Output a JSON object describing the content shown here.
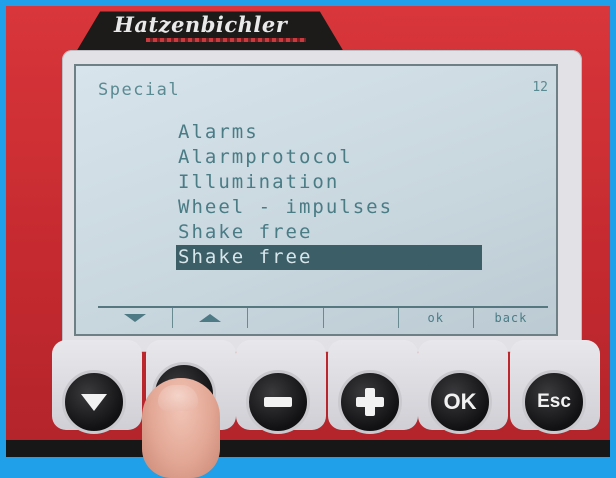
{
  "device": {
    "brand": "Hatzenbichler",
    "accent_color": "#c52a30"
  },
  "screen": {
    "title": "Special",
    "page_number": "12",
    "menu_items": [
      {
        "label": "Alarms",
        "selected": false
      },
      {
        "label": "Alarmprotocol",
        "selected": false
      },
      {
        "label": "Illumination",
        "selected": false
      },
      {
        "label": "Wheel - impulses",
        "selected": false
      },
      {
        "label": "Shake free",
        "selected": false
      },
      {
        "label": "Shake free",
        "selected": true
      }
    ],
    "softkeys": [
      {
        "icon": "down-arrow-icon",
        "label": ""
      },
      {
        "icon": "up-arrow-icon",
        "label": ""
      },
      {
        "icon": "",
        "label": ""
      },
      {
        "icon": "",
        "label": ""
      },
      {
        "icon": "",
        "label": "ok"
      },
      {
        "icon": "",
        "label": "back"
      }
    ]
  },
  "buttons": [
    {
      "name": "down-button",
      "icon": "down-arrow-icon",
      "label": ""
    },
    {
      "name": "up-button",
      "icon": "up-arrow-icon",
      "label": ""
    },
    {
      "name": "minus-button",
      "icon": "minus-icon",
      "label": ""
    },
    {
      "name": "plus-button",
      "icon": "plus-icon",
      "label": ""
    },
    {
      "name": "ok-button",
      "icon": "",
      "label": "OK"
    },
    {
      "name": "esc-button",
      "icon": "",
      "label": "Esc"
    }
  ]
}
